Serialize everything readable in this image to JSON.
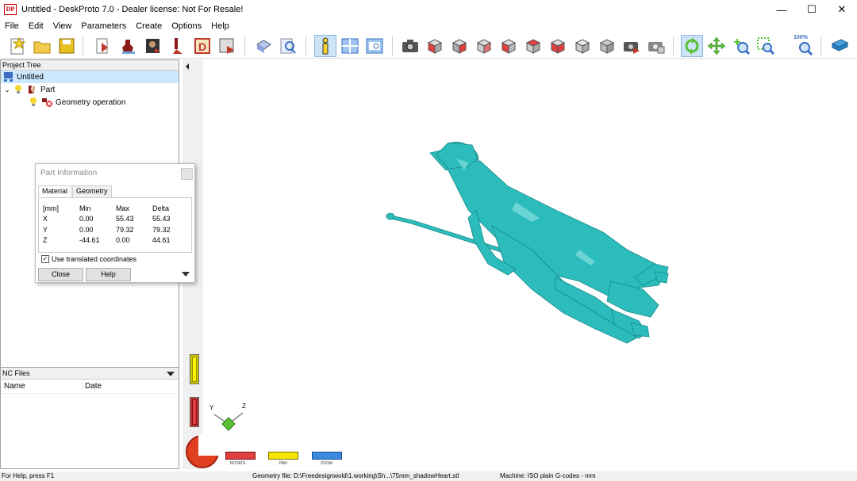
{
  "window": {
    "title": "Untitled - DeskProto 7.0 - Dealer license: Not For Resale!",
    "app_icon_text": "DP",
    "minimize": "—",
    "maximize": "☐",
    "close": "✕"
  },
  "menu": [
    "File",
    "Edit",
    "View",
    "Parameters",
    "Create",
    "Options",
    "Help"
  ],
  "toolbar": {
    "zoom_label": "100%"
  },
  "project_tree": {
    "header": "Project Tree",
    "items": [
      {
        "label": "Untitled"
      },
      {
        "label": "Part"
      },
      {
        "label": "Geometry operation"
      }
    ]
  },
  "nc_files": {
    "header": "NC Files",
    "columns": [
      "Name",
      "Date"
    ]
  },
  "part_info": {
    "title": "Part Information",
    "tabs": [
      "Material",
      "Geometry"
    ],
    "headers": [
      "[mm]",
      "Min",
      "Max",
      "Delta"
    ],
    "rows": [
      [
        "X",
        "0.00",
        "55.43",
        "55.43"
      ],
      [
        "Y",
        "0.00",
        "79.32",
        "79.32"
      ],
      [
        "Z",
        "-44.61",
        "0.00",
        "44.61"
      ]
    ],
    "checkbox_label": "Use translated coordinates",
    "close_label": "Close",
    "help_label": "Help"
  },
  "viewport": {
    "axis_y": "Y",
    "axis_z": "Z",
    "rotate_label": "ROTATE",
    "pan_label": "PAN",
    "zoom_label": "ZOOM",
    "model_color": "#2cbcbc"
  },
  "status": {
    "help": "For Help, press F1",
    "geometry": "Geometry file: D:\\Freedesignwold\\1.working\\Sh...\\75mm_shadowHeart.stl",
    "machine": "Machine: ISO plain G-codes - mm"
  }
}
